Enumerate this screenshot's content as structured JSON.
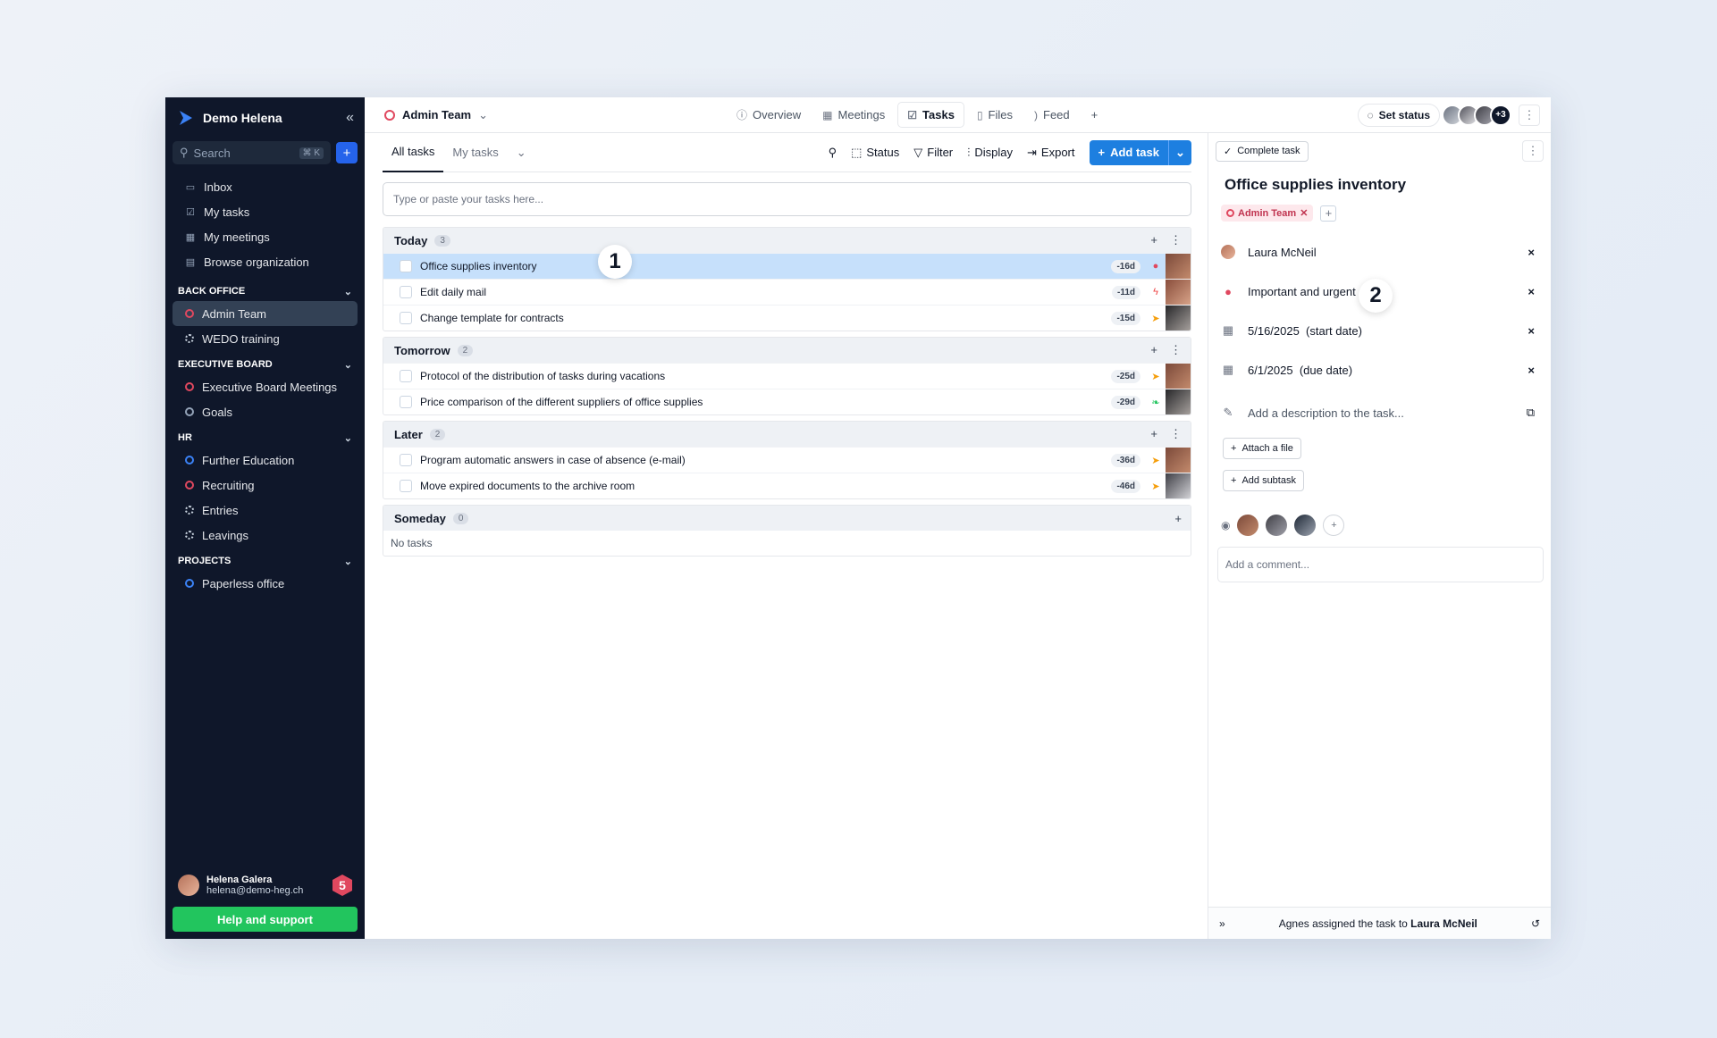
{
  "sidebar": {
    "org_name": "Demo Helena",
    "search_placeholder": "Search",
    "search_shortcut": "⌘ K",
    "nav": [
      {
        "label": "Inbox"
      },
      {
        "label": "My tasks"
      },
      {
        "label": "My meetings"
      },
      {
        "label": "Browse organization"
      }
    ],
    "sections": [
      {
        "title": "BACK OFFICE",
        "items": [
          {
            "label": "Admin Team"
          },
          {
            "label": "WEDO training"
          }
        ]
      },
      {
        "title": "EXECUTIVE BOARD",
        "items": [
          {
            "label": "Executive Board Meetings"
          },
          {
            "label": "Goals"
          }
        ]
      },
      {
        "title": "HR",
        "items": [
          {
            "label": "Further Education"
          },
          {
            "label": "Recruiting"
          },
          {
            "label": "Entries"
          },
          {
            "label": "Leavings"
          }
        ]
      },
      {
        "title": "PROJECTS",
        "items": [
          {
            "label": "Paperless office"
          }
        ]
      }
    ],
    "user": {
      "name": "Helena Galera",
      "email": "helena@demo-heg.ch",
      "badge": "5"
    },
    "help_label": "Help and support"
  },
  "topbar": {
    "team": "Admin Team",
    "tabs": [
      {
        "label": "Overview"
      },
      {
        "label": "Meetings"
      },
      {
        "label": "Tasks"
      },
      {
        "label": "Files"
      },
      {
        "label": "Feed"
      }
    ],
    "set_status": "Set status",
    "more_members": "+3"
  },
  "tasks": {
    "subtabs": [
      {
        "label": "All tasks"
      },
      {
        "label": "My tasks"
      }
    ],
    "actions": {
      "status": "Status",
      "filter": "Filter",
      "display": "Display",
      "export": "Export",
      "add_task": "Add task"
    },
    "quick_placeholder": "Type or paste your tasks here...",
    "groups": [
      {
        "title": "Today",
        "count": "3",
        "rows": [
          {
            "title": "Office supplies inventory",
            "due": "-16d",
            "priority_icon": "fire-icon"
          },
          {
            "title": "Edit daily mail",
            "due": "-11d",
            "priority_icon": "flash-icon"
          },
          {
            "title": "Change template for contracts",
            "due": "-15d",
            "priority_icon": "paper-plane-icon"
          }
        ]
      },
      {
        "title": "Tomorrow",
        "count": "2",
        "rows": [
          {
            "title": "Protocol of the distribution of tasks during vacations",
            "due": "-25d",
            "priority_icon": "paper-plane-icon"
          },
          {
            "title": "Price comparison of the different suppliers of office supplies",
            "due": "-29d",
            "priority_icon": "leaf-icon"
          }
        ]
      },
      {
        "title": "Later",
        "count": "2",
        "rows": [
          {
            "title": "Program automatic answers in case of absence (e-mail)",
            "due": "-36d",
            "priority_icon": "paper-plane-icon"
          },
          {
            "title": "Move expired documents to the archive room",
            "due": "-46d",
            "priority_icon": "paper-plane-icon"
          }
        ]
      },
      {
        "title": "Someday",
        "count": "0",
        "empty": "No tasks"
      }
    ],
    "marker_1": "1"
  },
  "detail": {
    "complete_label": "Complete task",
    "title": "Office supplies inventory",
    "tag": "Admin Team",
    "assignee": "Laura McNeil",
    "priority": "Important and urgent",
    "start_date": "5/16/2025  (start date)",
    "due_date": "6/1/2025  (due date)",
    "description_placeholder": "Add a description to the task...",
    "attach_label": "Attach a file",
    "subtask_label": "Add subtask",
    "comment_placeholder": "Add a comment...",
    "footer_prefix": "Agnes assigned the task to ",
    "footer_name": "Laura McNeil",
    "marker_2": "2"
  },
  "colors": {
    "sidebar_bg": "#0f172a",
    "accent": "#1d7fe0",
    "selected_row": "#c6e0fb",
    "help_button": "#22c55e",
    "team_red": "#e0485f"
  }
}
